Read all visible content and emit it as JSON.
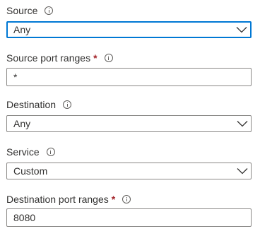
{
  "fields": [
    {
      "label": "Source",
      "required": false,
      "type": "dropdown",
      "value": "Any",
      "focused": true
    },
    {
      "label": "Source port ranges",
      "required": true,
      "type": "text",
      "value": "*"
    },
    {
      "label": "Destination",
      "required": false,
      "type": "dropdown",
      "value": "Any"
    },
    {
      "label": "Service",
      "required": false,
      "type": "dropdown",
      "value": "Custom"
    },
    {
      "label": "Destination port ranges",
      "required": true,
      "type": "text",
      "value": "8080"
    }
  ],
  "required_marker": "*",
  "colors": {
    "focus_border": "#0078d4",
    "border": "#8a8886",
    "required": "#a4262c",
    "text": "#323130"
  },
  "icons": {
    "info": "info-icon",
    "dropdown": "chevron-down-icon"
  }
}
